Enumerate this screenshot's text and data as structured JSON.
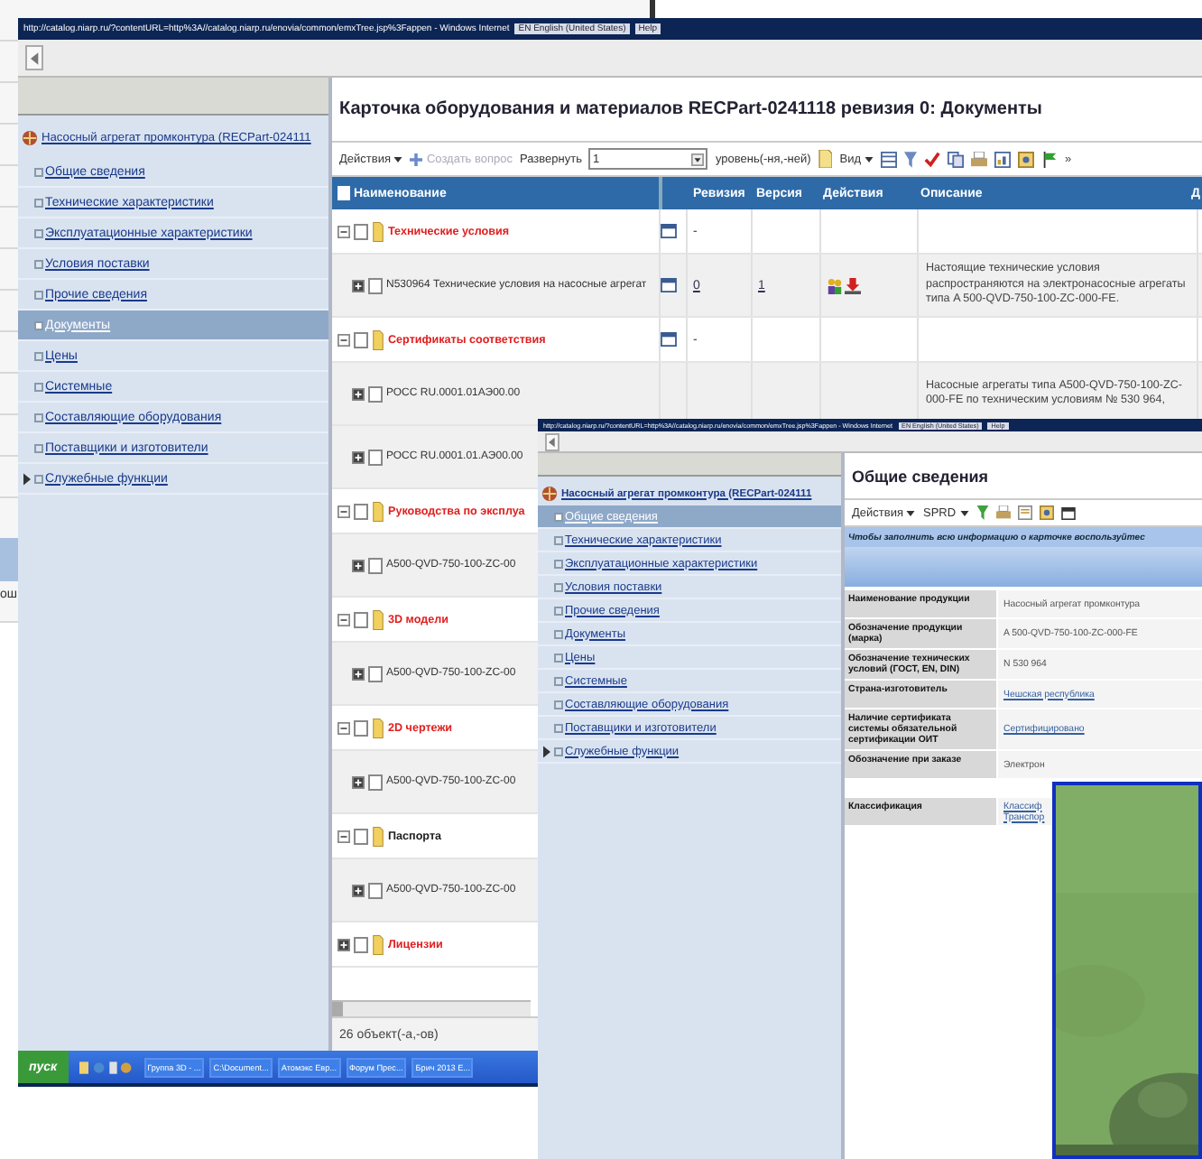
{
  "background_window": {
    "fragment": "ош"
  },
  "main_window": {
    "title_bar": {
      "url": "http://catalog.niarp.ru/?contentURL=http%3A//catalog.niarp.ru/enovia/common/emxTree.jsp%3Fappen - Windows Internet",
      "language": "EN English (United States)",
      "help": "Help"
    },
    "tree": {
      "root": "Насосный агрегат промконтура (RECPart-024111",
      "items": [
        {
          "label": "Общие сведения",
          "selected": false,
          "expandable": false
        },
        {
          "label": "Технические характеристики",
          "selected": false,
          "expandable": false
        },
        {
          "label": "Эксплуатационные характеристики",
          "selected": false,
          "expandable": false
        },
        {
          "label": "Условия поставки",
          "selected": false,
          "expandable": false
        },
        {
          "label": "Прочие сведения",
          "selected": false,
          "expandable": false
        },
        {
          "label": "Документы",
          "selected": true,
          "expandable": false
        },
        {
          "label": "Цены",
          "selected": false,
          "expandable": false
        },
        {
          "label": "Системные",
          "selected": false,
          "expandable": false
        },
        {
          "label": "Составляющие оборудования",
          "selected": false,
          "expandable": false
        },
        {
          "label": "Поставщики и изготовители",
          "selected": false,
          "expandable": false
        },
        {
          "label": "Служебные функции",
          "selected": false,
          "expandable": true
        }
      ]
    },
    "page_title": "Карточка оборудования и материалов RECPart-0241118 ревизия 0: Документы",
    "toolbar": {
      "actions": "Действия",
      "create": {
        "label": "Создать вопрос",
        "disabled": true
      },
      "expand_label": "Развернуть",
      "level_value": "1",
      "level_label": "уровень(-ня,-ней)",
      "view": "Вид",
      "more": "»"
    },
    "table": {
      "columns": [
        "Наименование",
        "Ревизия",
        "Версия",
        "Действия",
        "Описание",
        "Д"
      ],
      "rows": [
        {
          "kind": "group",
          "name": "Технические условия",
          "color": "#e02020",
          "expanded": true,
          "checked": false,
          "revision": "-"
        },
        {
          "kind": "item",
          "name": "N530964 Технические условия на насосные агрегат",
          "checked": false,
          "revision": "0",
          "version": "1",
          "has_actions": true,
          "description": "Настоящие технические условия распространяются на электронасосные агрегаты типа A 500-QVD-750-100-ZC-000-FE."
        },
        {
          "kind": "group",
          "name": "Сертификаты соответствия",
          "color": "#e02020",
          "expanded": true,
          "checked": false,
          "revision": "-"
        },
        {
          "kind": "item",
          "name": "РОСС RU.0001.01АЭ00.00",
          "checked": false,
          "description": "Насосные агрегаты типа A500-QVD-750-100-ZC-000-FE по техническим условиям № 530 964,"
        },
        {
          "kind": "item",
          "name": "РОСС RU.0001.01.АЭ00.00",
          "checked": false
        },
        {
          "kind": "group",
          "name": "Руководства по эксплуа",
          "color": "#e02020",
          "expanded": true,
          "checked": false
        },
        {
          "kind": "item",
          "name": "A500-QVD-750-100-ZC-00",
          "checked": false
        },
        {
          "kind": "group",
          "name": "3D модели",
          "color": "#e02020",
          "expanded": true,
          "checked": false
        },
        {
          "kind": "item",
          "name": "A500-QVD-750-100-ZC-00",
          "checked": false
        },
        {
          "kind": "group",
          "name": "2D чертежи",
          "color": "#e02020",
          "expanded": true,
          "checked": false
        },
        {
          "kind": "item",
          "name": "A500-QVD-750-100-ZC-00",
          "checked": false
        },
        {
          "kind": "group",
          "name": "Паспорта",
          "color": "#222222",
          "expanded": true,
          "checked": false
        },
        {
          "kind": "item",
          "name": "A500-QVD-750-100-ZC-00",
          "checked": false
        },
        {
          "kind": "group",
          "name": "Лицензии",
          "color": "#e02020",
          "expanded": false,
          "checked": false
        }
      ]
    },
    "status": "26 объект(-а,-ов)"
  },
  "taskbar": {
    "start": "пуск",
    "tasks": [
      "Группа 3D - ...",
      "C:\\Document...",
      "Атомэкс Евр...",
      "Форум Прес...",
      "Брич 2013 E..."
    ]
  },
  "second_window": {
    "title_bar": {
      "url": "http://catalog.niarp.ru/?contentURL=http%3A//catalog.niarp.ru/enovia/common/emxTree.jsp%3Fappen - Windows Internet",
      "language": "EN English (United States)",
      "help": "Help"
    },
    "tree": {
      "root": "Насосный агрегат промконтура (RECPart-024111",
      "items": [
        {
          "label": "Общие сведения",
          "selected": true,
          "expandable": false
        },
        {
          "label": "Технические характеристики",
          "selected": false,
          "expandable": false
        },
        {
          "label": "Эксплуатационные характеристики",
          "selected": false,
          "expandable": false
        },
        {
          "label": "Условия поставки",
          "selected": false,
          "expandable": false
        },
        {
          "label": "Прочие сведения",
          "selected": false,
          "expandable": false
        },
        {
          "label": "Документы",
          "selected": false,
          "expandable": false
        },
        {
          "label": "Цены",
          "selected": false,
          "expandable": false
        },
        {
          "label": "Системные",
          "selected": false,
          "expandable": false
        },
        {
          "label": "Составляющие оборудования",
          "selected": false,
          "expandable": false
        },
        {
          "label": "Поставщики и изготовители",
          "selected": false,
          "expandable": false
        },
        {
          "label": "Служебные функции",
          "selected": false,
          "expandable": true
        }
      ]
    },
    "page_title": "Общие сведения",
    "toolbar": {
      "actions": "Действия",
      "sprd": "SPRD"
    },
    "notice": "Чтобы заполнить всю информацию о карточке воспользуйтес",
    "form": [
      {
        "label": "Наименование продукции",
        "kind": "text",
        "values": [
          "Насосный агрегат промконтура"
        ]
      },
      {
        "label": "Обозначение продукции (марка)",
        "kind": "text",
        "values": [
          "A 500-QVD-750-100-ZC-000-FE"
        ]
      },
      {
        "label": "Обозначение технических условий (ГОСТ, EN, DIN)",
        "kind": "text",
        "values": [
          "N 530 964"
        ]
      },
      {
        "label": "Страна-изготовитель",
        "kind": "link",
        "values": [
          "Чешская республика"
        ]
      },
      {
        "label": "Наличие сертификата системы обязательной сертификации ОИТ",
        "kind": "link",
        "values": [
          "Сертифицировано"
        ]
      },
      {
        "label": "Обозначение при заказе",
        "kind": "text",
        "values": [
          "Электрон"
        ]
      },
      {
        "label": "Классификация",
        "kind": "link",
        "values": [
          "Классиф",
          "Транспор"
        ]
      }
    ]
  }
}
